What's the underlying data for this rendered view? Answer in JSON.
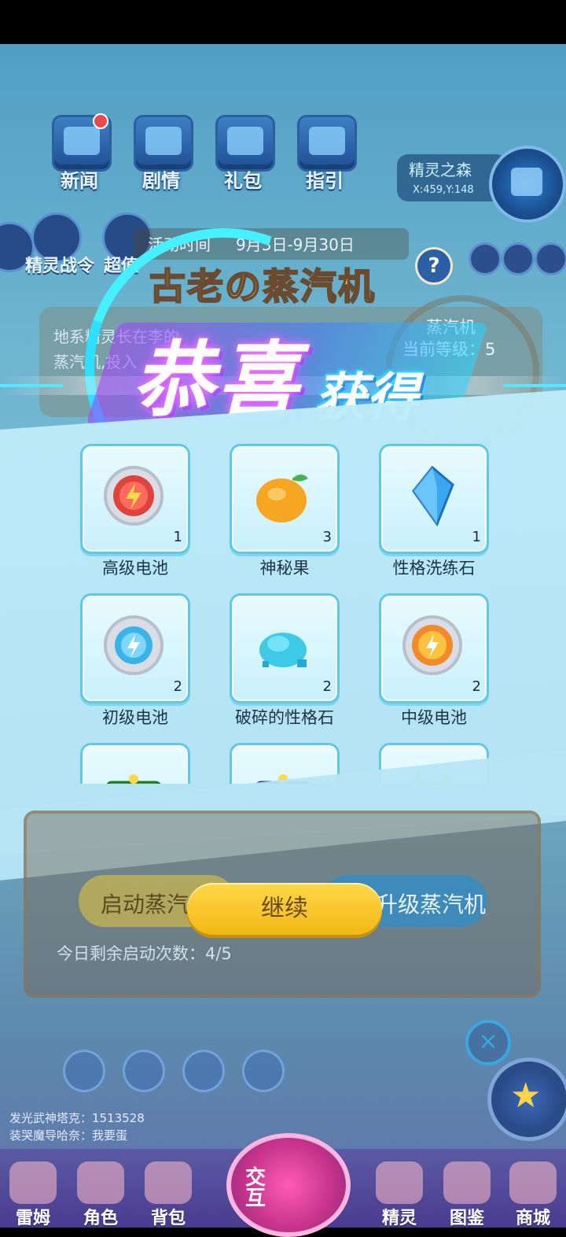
{
  "top_menu": [
    {
      "label": "新闻",
      "icon": "news-tv-icon",
      "badge": true
    },
    {
      "label": "剧情",
      "icon": "story-book-icon",
      "badge": false
    },
    {
      "label": "礼包",
      "icon": "gift-chest-icon",
      "badge": false
    },
    {
      "label": "指引",
      "icon": "guide-book-icon",
      "badge": false
    }
  ],
  "location": {
    "name": "精灵之森",
    "coords": "X:459,Y:148"
  },
  "side_icons": [
    {
      "label": "精灵战令"
    },
    {
      "label": "超值"
    }
  ],
  "event": {
    "time_label": "活动时间",
    "time_value": "9月3日-9月30日",
    "title": "古老の蒸汽机",
    "desc_line1": "地系精灵长在李的",
    "desc_line2": "蒸汽机,投入",
    "machine_label": "蒸汽机",
    "level_label": "当前等级：5",
    "explain_label": "说明"
  },
  "banner": {
    "main": "恭喜",
    "sub": "获得"
  },
  "rewards": [
    {
      "name": "高级电池",
      "count": "1",
      "icon": "red-battery-gear-icon"
    },
    {
      "name": "神秘果",
      "count": "3",
      "icon": "orange-fruit-icon"
    },
    {
      "name": "性格洗练石",
      "count": "1",
      "icon": "blue-crystal-icon"
    },
    {
      "name": "初级电池",
      "count": "2",
      "icon": "blue-battery-gear-icon"
    },
    {
      "name": "破碎的性格石",
      "count": "2",
      "icon": "crystal-shards-icon"
    },
    {
      "name": "中级电池",
      "count": "2",
      "icon": "gold-battery-gear-icon"
    },
    {
      "name": "",
      "count": "",
      "icon": "green-chest-icon"
    },
    {
      "name": "",
      "count": "",
      "icon": "blue-chest-icon"
    },
    {
      "name": "",
      "count": "",
      "icon": "yellow-cat-icon"
    }
  ],
  "machine_panel": {
    "start_label": "启动蒸汽机",
    "upgrade_label": "升级蒸汽机",
    "today_left": "今日剩余启动次数：4/5"
  },
  "continue_label": "继续",
  "chat": [
    "发光武神塔克：1513528",
    "装哭魔导哈奈：我要蛋"
  ],
  "bottom_nav": [
    {
      "label": "雷姆",
      "icon": "rem-icon"
    },
    {
      "label": "角色",
      "icon": "character-icon"
    },
    {
      "label": "背包",
      "icon": "backpack-icon"
    },
    {
      "label": "精灵",
      "icon": "sprite-icon"
    },
    {
      "label": "图鉴",
      "icon": "handbook-icon"
    },
    {
      "label": "商城",
      "icon": "shop-icon"
    }
  ],
  "center_button": "交互",
  "colors": {
    "accent_cyan": "#45f1ff",
    "continue_yellow": "#f2b716",
    "panel_blue": "#c8f0fb"
  }
}
